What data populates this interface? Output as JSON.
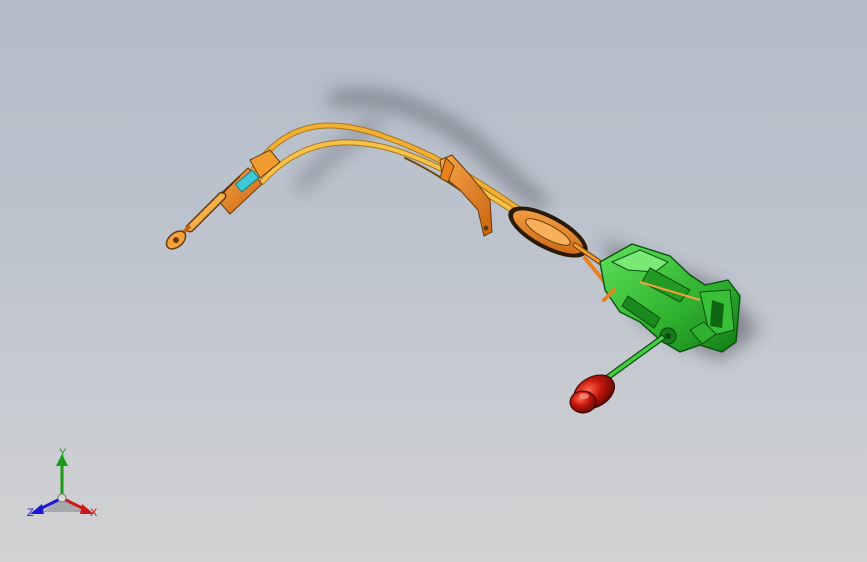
{
  "viewport": {
    "background_top": "#b3bcc8",
    "background_bottom": "#d2d2d3"
  },
  "model": {
    "parts": {
      "cable_color": "#f2b032",
      "bracket_color": "#e8821e",
      "housing_color": "#2fb12f",
      "knob_color": "#c8180c",
      "clip_color": "#3fc8d8"
    }
  },
  "triad": {
    "x_label": "X",
    "y_label": "Y",
    "z_label": "Z",
    "x_color": "#cc1a1a",
    "y_color": "#1a9a1a",
    "z_color": "#1a1ad0"
  }
}
